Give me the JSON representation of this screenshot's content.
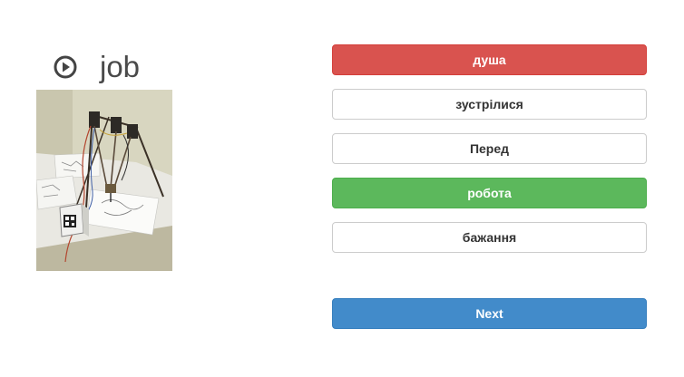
{
  "prompt": {
    "word": "job",
    "audio_icon": "play-circle-icon",
    "image_alt": "delta robot drawing machine photo"
  },
  "options": [
    {
      "label": "душа",
      "state": "incorrect"
    },
    {
      "label": "зустрілися",
      "state": "default"
    },
    {
      "label": "Перед",
      "state": "default"
    },
    {
      "label": "робота",
      "state": "correct"
    },
    {
      "label": "бажання",
      "state": "default"
    }
  ],
  "next": {
    "label": "Next"
  },
  "colors": {
    "incorrect": "#d9534f",
    "correct": "#5cb85c",
    "primary": "#428bca",
    "text": "#333333"
  }
}
